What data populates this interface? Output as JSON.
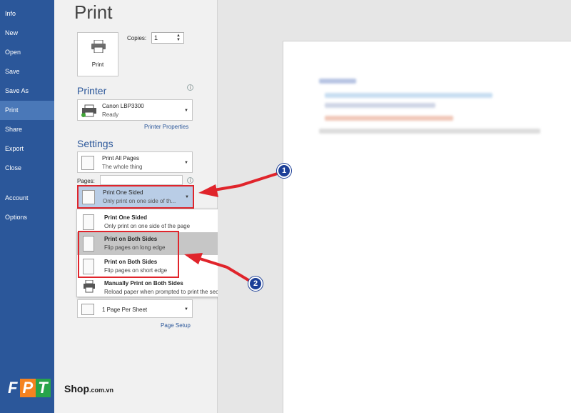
{
  "sidebar": {
    "items": [
      {
        "label": "Info"
      },
      {
        "label": "New"
      },
      {
        "label": "Open"
      },
      {
        "label": "Save"
      },
      {
        "label": "Save As"
      },
      {
        "label": "Print"
      },
      {
        "label": "Share"
      },
      {
        "label": "Export"
      },
      {
        "label": "Close"
      },
      {
        "label": "Account"
      },
      {
        "label": "Options"
      }
    ],
    "active": "Print"
  },
  "page_title": "Print",
  "print_button": {
    "label": "Print",
    "icon": "printer-icon"
  },
  "copies": {
    "label": "Copies:",
    "value": "1"
  },
  "printer": {
    "heading": "Printer",
    "name": "Canon LBP3300",
    "status": "Ready",
    "properties_link": "Printer Properties"
  },
  "settings": {
    "heading": "Settings",
    "print_range": {
      "main": "Print All Pages",
      "sub": "The whole thing"
    },
    "pages_label": "Pages:",
    "pages_value": "",
    "sides": {
      "main": "Print One Sided",
      "sub": "Only print on one side of th..."
    },
    "per_sheet": {
      "main": "1 Page Per Sheet"
    },
    "page_setup_link": "Page Setup"
  },
  "sides_menu": {
    "options": [
      {
        "title": "Print One Sided",
        "sub": "Only print on one side of the page"
      },
      {
        "title": "Print on Both Sides",
        "sub": "Flip pages on long edge"
      },
      {
        "title": "Print on Both Sides",
        "sub": "Flip pages on short edge"
      },
      {
        "title": "Manually Print on Both Sides",
        "sub": "Reload paper when prompted to print the second side"
      }
    ]
  },
  "annotations": {
    "step1": "1",
    "step2": "2"
  },
  "watermark": {
    "brand": "FPT",
    "shop": "Shop",
    "domain": ".com.vn"
  },
  "colors": {
    "accent": "#2b579a",
    "highlight": "#e0242b",
    "badge": "#1c3f97"
  }
}
